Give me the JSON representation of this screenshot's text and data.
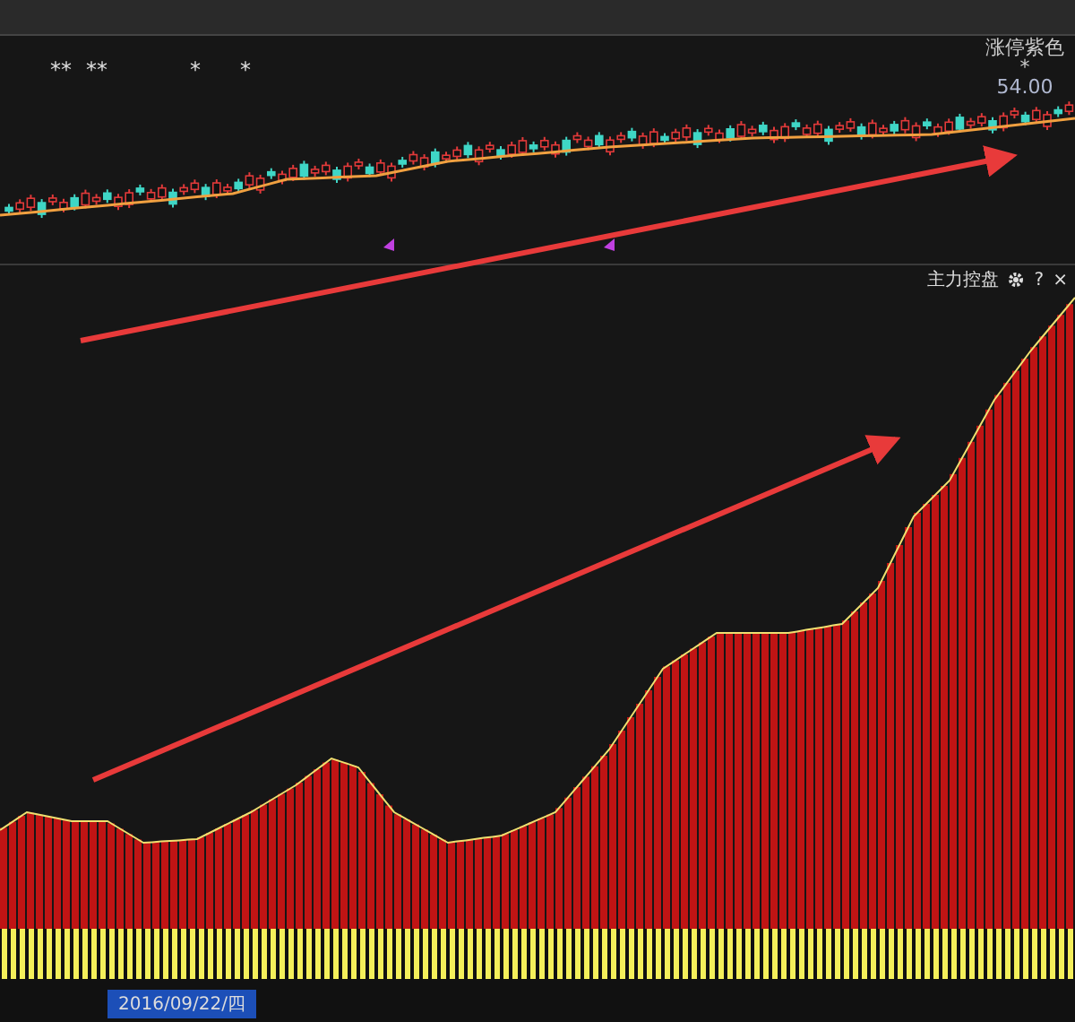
{
  "top_markers": [
    {
      "text": "**"
    },
    {
      "text": "**"
    },
    {
      "text": "*"
    },
    {
      "text": "*"
    }
  ],
  "price_panel": {
    "legend": "涨停紫色",
    "legend_marker": "*",
    "price_label": "54.00"
  },
  "indicator_panel": {
    "title": "主力控盘",
    "help": "?",
    "close": "×"
  },
  "time_axis": {
    "cursor_date": "2016/09/22/四"
  }
}
